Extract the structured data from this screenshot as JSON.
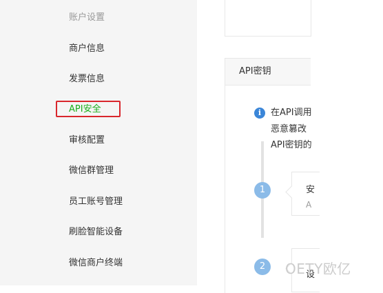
{
  "sidebar": {
    "group_label": "账户设置",
    "items": [
      {
        "label": "商户信息"
      },
      {
        "label": "发票信息"
      },
      {
        "label": "API安全"
      },
      {
        "label": "审核配置"
      },
      {
        "label": "微信群管理"
      },
      {
        "label": "员工账号管理"
      },
      {
        "label": "刷脸智能设备"
      },
      {
        "label": "微信商户终端"
      }
    ],
    "active_color": "#1aad19",
    "highlight_border_color": "#d9262c"
  },
  "main": {
    "panel_title": "API密钥",
    "info_icon": "info-icon",
    "info_lines": [
      "在API调用",
      "恶意篡改",
      "API密钥的"
    ],
    "steps": [
      {
        "number": "1",
        "title": "安",
        "subtitle": "A"
      },
      {
        "number": "2",
        "title": "设"
      }
    ]
  },
  "watermark": "OETY欧亿",
  "colors": {
    "step_circle": "#8bbbe8",
    "info_icon": "#3b86d8"
  }
}
